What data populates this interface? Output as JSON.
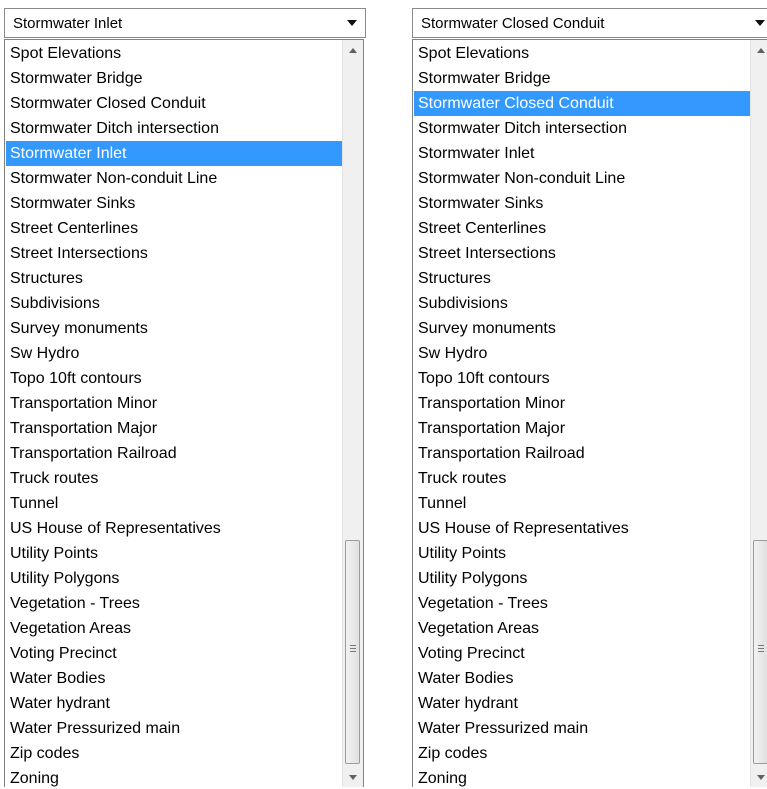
{
  "left_combo": {
    "selected_value": "Stormwater Inlet",
    "items": [
      "Spot Elevations",
      "Stormwater Bridge",
      "Stormwater Closed Conduit",
      "Stormwater Ditch intersection",
      "Stormwater Inlet",
      "Stormwater Non-conduit Line",
      "Stormwater Sinks",
      "Street Centerlines",
      "Street Intersections",
      "Structures",
      "Subdivisions",
      "Survey monuments",
      "Sw Hydro",
      "Topo 10ft contours",
      "Transportation Minor",
      "Transportation Major",
      "Transportation Railroad",
      "Truck routes",
      "Tunnel",
      "US House of Representatives",
      "Utility Points",
      "Utility Polygons",
      "Vegetation - Trees",
      "Vegetation Areas",
      "Voting Precinct",
      "Water Bodies",
      "Water hydrant",
      "Water Pressurized main",
      "Zip codes",
      "Zoning"
    ]
  },
  "right_combo": {
    "selected_value": "Stormwater Closed Conduit",
    "items": [
      "Spot Elevations",
      "Stormwater Bridge",
      "Stormwater Closed Conduit",
      "Stormwater Ditch intersection",
      "Stormwater Inlet",
      "Stormwater Non-conduit Line",
      "Stormwater Sinks",
      "Street Centerlines",
      "Street Intersections",
      "Structures",
      "Subdivisions",
      "Survey monuments",
      "Sw Hydro",
      "Topo 10ft contours",
      "Transportation Minor",
      "Transportation Major",
      "Transportation Railroad",
      "Truck routes",
      "Tunnel",
      "US House of Representatives",
      "Utility Points",
      "Utility Polygons",
      "Vegetation - Trees",
      "Vegetation Areas",
      "Voting Precinct",
      "Water Bodies",
      "Water hydrant",
      "Water Pressurized main",
      "Zip codes",
      "Zoning"
    ]
  },
  "colors": {
    "selection": "#3399ff",
    "border": "#8a8a8a",
    "scrollbar_track": "#f0f0f0"
  },
  "icons": {
    "dropdown": "chevron-down-icon",
    "scroll_up": "scroll-up-icon",
    "scroll_down": "scroll-down-icon"
  }
}
